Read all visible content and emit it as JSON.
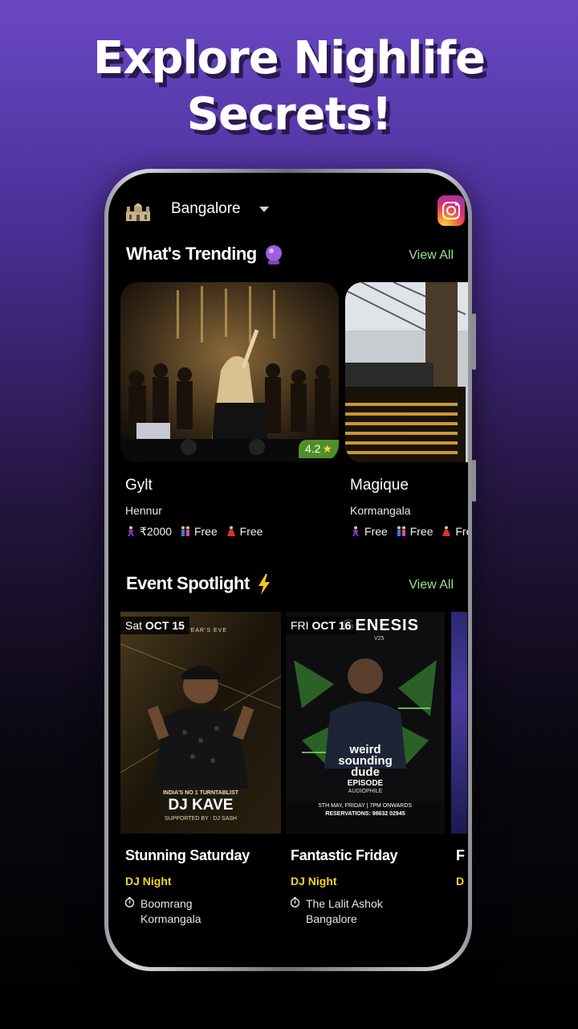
{
  "headline": {
    "line1": "Explore Nighlife",
    "line2": "Secrets!"
  },
  "topbar": {
    "city": "Bangalore",
    "city_icon": "palace-icon",
    "dropdown_icon": "chevron-down-icon",
    "social_icon": "instagram-icon"
  },
  "trending": {
    "title": "What's Trending",
    "title_emoji": "crystal-ball-icon",
    "view_all": "View All",
    "items": [
      {
        "name": "Gylt",
        "location": "Hennur",
        "rating": "4.2",
        "stag": "₹2000",
        "couple": "Free",
        "female": "Free"
      },
      {
        "name": "Magique",
        "location": "Kormangala",
        "stag": "Free",
        "couple": "Free",
        "female": "Free"
      }
    ]
  },
  "spotlight": {
    "title": "Event Spotlight",
    "title_emoji": "lightning-icon",
    "view_all": "View All",
    "events": [
      {
        "day": "Sat",
        "date": "OCT 15",
        "name": "Stunning Saturday",
        "type": "DJ Night",
        "venue_line1": "Boomrang",
        "venue_line2": "Kormangala",
        "poster": {
          "top": "YEAR'S EVE",
          "sub": "INDIA'S NO 1 TURNTABLIST",
          "headline": "DJ KAVE",
          "support": "SUPPORTED BY : DJ SASH"
        }
      },
      {
        "day": "FRI",
        "date": "OCT 16",
        "name": "Fantastic Friday",
        "type": "DJ Night",
        "venue_line1": "The Lalit Ashok",
        "venue_line2": "Bangalore",
        "poster": {
          "top": "GENESIS",
          "tag": "V25",
          "line1": "weird",
          "line2": "sounding",
          "line3": "dude",
          "line4": "EPISODE",
          "line5": "AUDIOPHILE",
          "line6": "5TH MAY, FRIDAY | 7PM ONWARDS",
          "line7": "RESERVATIONS: 98632 02945"
        }
      },
      {
        "name": "F",
        "type": "D"
      }
    ]
  },
  "colors": {
    "accent_green": "#9be58f",
    "event_type": "#f5d12a",
    "rating_bg": "#4e8f2a"
  }
}
